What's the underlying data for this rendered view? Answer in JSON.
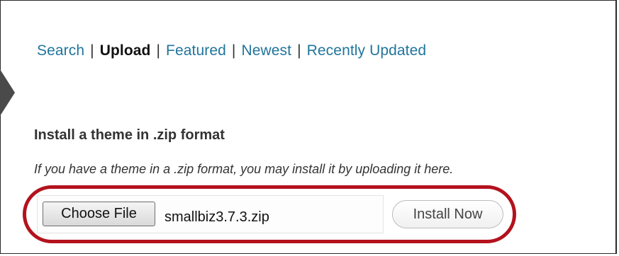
{
  "nav": {
    "search": "Search",
    "upload": "Upload",
    "featured": "Featured",
    "newest": "Newest",
    "recently_updated": "Recently Updated",
    "separator": "|"
  },
  "section": {
    "heading": "Install a theme in .zip format",
    "description": "If you have a theme in a .zip format, you may install it by uploading it here."
  },
  "upload": {
    "choose_file_label": "Choose File",
    "selected_file": "smallbiz3.7.3.zip",
    "install_label": "Install Now"
  },
  "colors": {
    "link": "#21759b",
    "highlight_ring": "#b3121d"
  },
  "icons": {
    "side_arrow": "triangle-right"
  }
}
